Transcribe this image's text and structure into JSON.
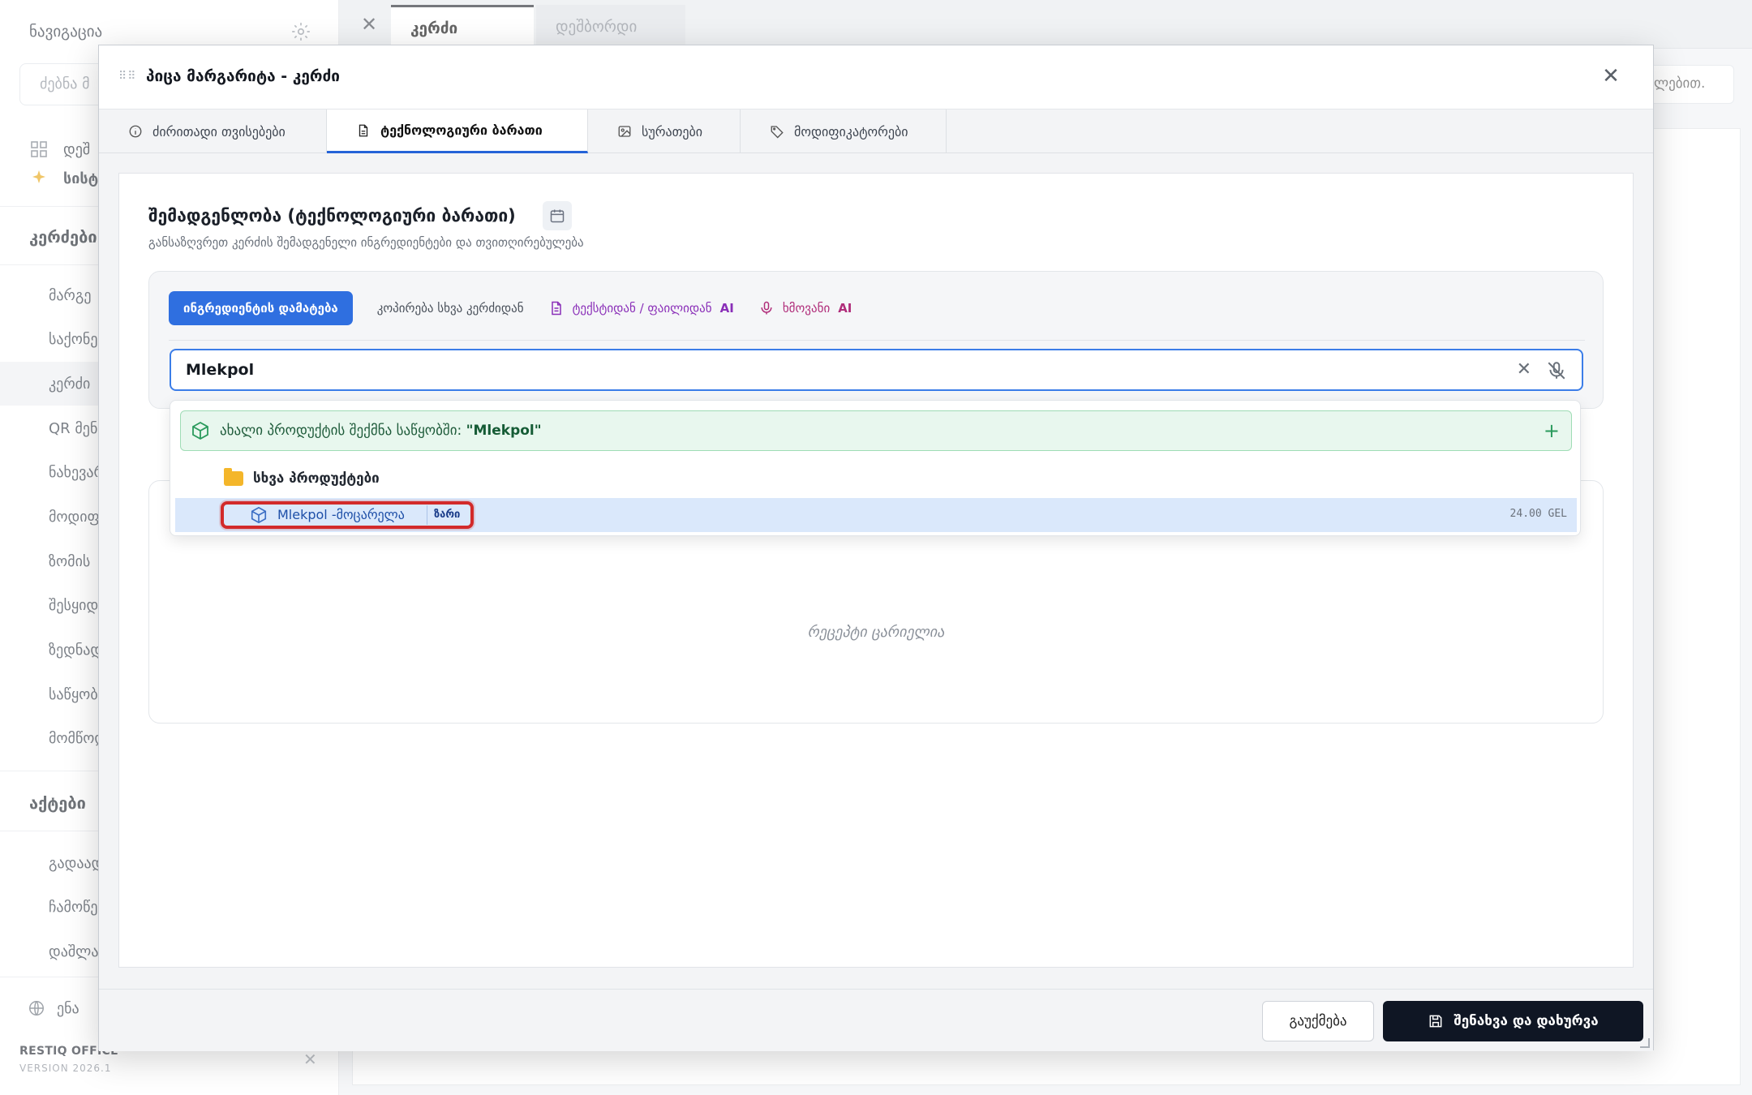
{
  "sidebar": {
    "nav_title": "ნავიგაცია",
    "search_placeholder": "ძებნა მ",
    "rows": [
      {
        "label": "დეშ"
      },
      {
        "label": "სისტ"
      }
    ],
    "section_cards": "კერძები",
    "items": [
      "მარგე",
      "საქონე",
      "კერძი",
      "QR მენი",
      "ნახევარ",
      "მოდიფ",
      "ზომის",
      "შესყიდ",
      "ზედნად",
      "საწყობ",
      "მომწოდ"
    ],
    "section_acts": "აქტები",
    "act_items": [
      "გადაად",
      "ჩამოწე",
      "დაშლა"
    ],
    "language": "ენა",
    "brand": "RESTIQ OFFICE",
    "version": "VERSION 2026.1"
  },
  "topbar": {
    "tabs": [
      {
        "label": "კერძი"
      },
      {
        "label": "დეშბორდი"
      }
    ],
    "right_search": "ლებით."
  },
  "modal": {
    "title": "პიცა მარგარიტა - კერძი",
    "tabs": [
      {
        "label": "ძირითადი თვისებები",
        "icon": "info-icon"
      },
      {
        "label": "ტექნოლოგიური ბარათი",
        "icon": "document-icon"
      },
      {
        "label": "სურათები",
        "icon": "image-icon"
      },
      {
        "label": "მოდიფიკატორები",
        "icon": "tag-icon"
      }
    ],
    "section_title": "შემადგენლობა (ტექნოლოგიური ბარათი)",
    "section_subtitle": "განსაზღვრეთ კერძის შემადგენელი ინგრედიენტები და თვითღირებულება",
    "toolbar": {
      "add_ingredient": "ინგრედიენტის დამატება",
      "copy_from_dish": "კოპირება სხვა კერძიდან",
      "from_text": "ტექსტიდან / ფაილიდან",
      "voice": "ხმოვანი",
      "ai": "AI"
    },
    "search": {
      "value": "Mlekpol"
    },
    "dropdown": {
      "create_prefix": "ახალი პროდუქტის შექმნა საწყობში:",
      "create_query": "\"Mlekpol\"",
      "group": "სხვა პროდუქტები",
      "item_name": "Mlekpol -მოცარელა",
      "item_tag": "ზარი",
      "item_price": "24.00 GEL"
    },
    "recipe_empty": "რეცეპტი ცარიელია",
    "footer": {
      "cancel": "გაუქმება",
      "save": "შენახვა და დახურვა"
    }
  },
  "colors": {
    "primary": "#2f6fe0",
    "dark_button": "#0f1624",
    "highlight_border": "#d22a2a",
    "selected_row": "#dae8fb",
    "create_bg": "#e8f7ee"
  }
}
